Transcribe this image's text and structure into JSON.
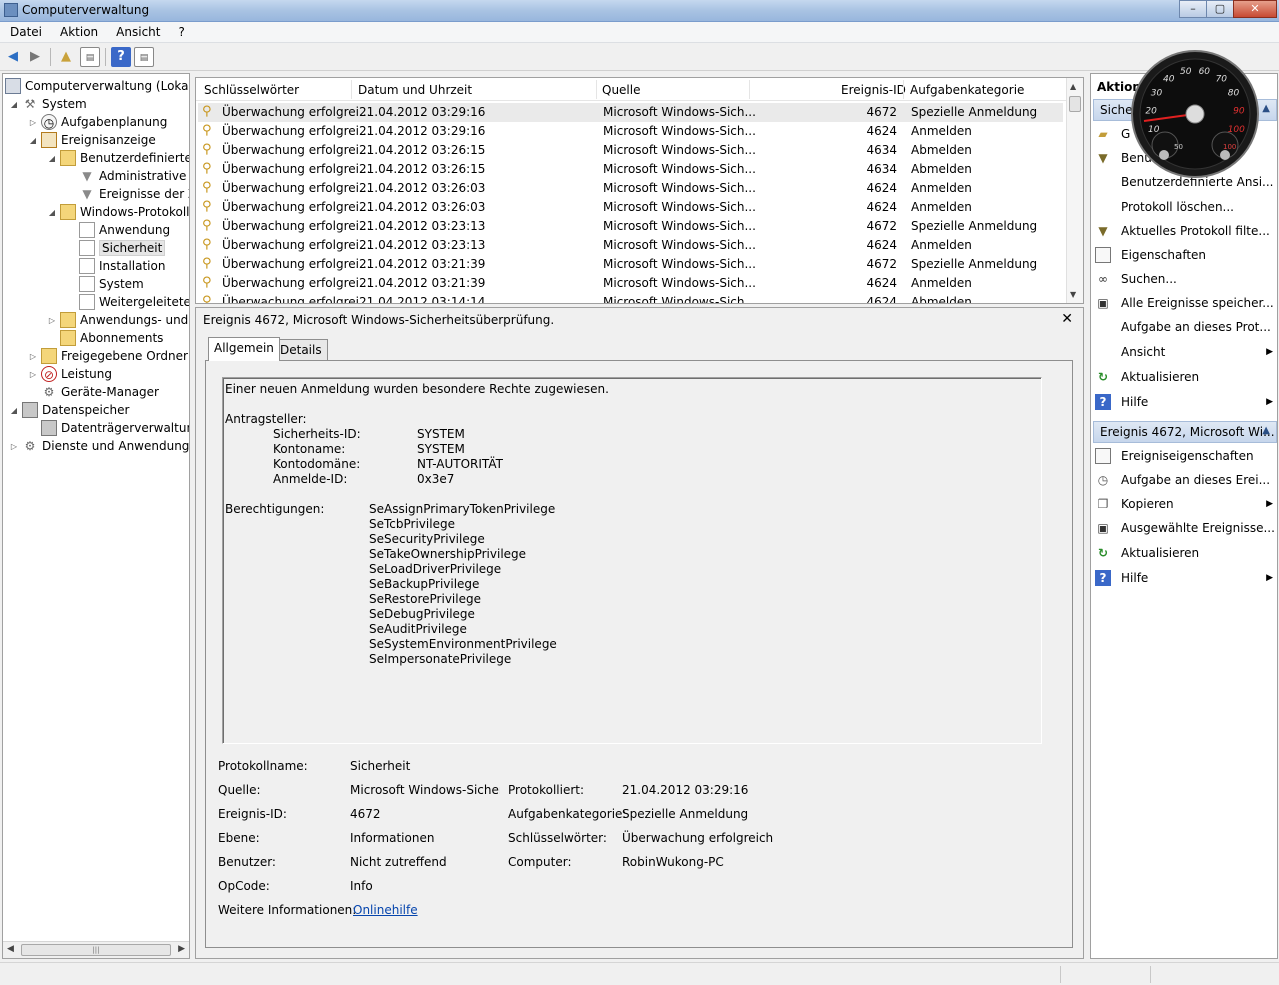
{
  "window": {
    "title": "Computerverwaltung",
    "buttons": [
      "–",
      "▢",
      "✕"
    ]
  },
  "menu": [
    "Datei",
    "Aktion",
    "Ansicht",
    "?"
  ],
  "tree": {
    "root": "Computerverwaltung (Lokal)",
    "system": "System",
    "tasks": "Aufgabenplanung",
    "eventviewer": "Ereignisanzeige",
    "custom_views": "Benutzerdefinierte A",
    "admin_events": "Administrative E",
    "events_of": "Ereignisse der Zu",
    "windows_logs": "Windows-Protokolle",
    "application": "Anwendung",
    "security": "Sicherheit",
    "setup": "Installation",
    "system_log": "System",
    "forwarded": "Weitergeleitete E",
    "app_logs": "Anwendungs- und D",
    "subscriptions": "Abonnements",
    "shared": "Freigegebene Ordner",
    "performance": "Leistung",
    "devices": "Geräte-Manager",
    "storage": "Datenspeicher",
    "disk_mgmt": "Datenträgerverwaltung",
    "services": "Dienste und Anwendungen"
  },
  "list": {
    "columns": [
      "Schlüsselwörter",
      "Datum und Uhrzeit",
      "Quelle",
      "Ereignis-ID",
      "Aufgabenkategorie"
    ],
    "rows": [
      [
        "Überwachung erfolgrei...",
        "21.04.2012 03:29:16",
        "Microsoft Windows-Sich...",
        "4672",
        "Spezielle Anmeldung"
      ],
      [
        "Überwachung erfolgrei...",
        "21.04.2012 03:29:16",
        "Microsoft Windows-Sich...",
        "4624",
        "Anmelden"
      ],
      [
        "Überwachung erfolgrei...",
        "21.04.2012 03:26:15",
        "Microsoft Windows-Sich...",
        "4634",
        "Abmelden"
      ],
      [
        "Überwachung erfolgrei...",
        "21.04.2012 03:26:15",
        "Microsoft Windows-Sich...",
        "4634",
        "Abmelden"
      ],
      [
        "Überwachung erfolgrei...",
        "21.04.2012 03:26:03",
        "Microsoft Windows-Sich...",
        "4624",
        "Anmelden"
      ],
      [
        "Überwachung erfolgrei...",
        "21.04.2012 03:26:03",
        "Microsoft Windows-Sich...",
        "4624",
        "Anmelden"
      ],
      [
        "Überwachung erfolgrei...",
        "21.04.2012 03:23:13",
        "Microsoft Windows-Sich...",
        "4672",
        "Spezielle Anmeldung"
      ],
      [
        "Überwachung erfolgrei...",
        "21.04.2012 03:23:13",
        "Microsoft Windows-Sich...",
        "4624",
        "Anmelden"
      ],
      [
        "Überwachung erfolgrei...",
        "21.04.2012 03:21:39",
        "Microsoft Windows-Sich...",
        "4672",
        "Spezielle Anmeldung"
      ],
      [
        "Überwachung erfolgrei...",
        "21.04.2012 03:21:39",
        "Microsoft Windows-Sich...",
        "4624",
        "Anmelden"
      ],
      [
        "Überwachung erfolgrei...",
        "21.04.2012 03:14:14",
        "Microsoft Windows-Sich...",
        "4624",
        "Abmelden"
      ]
    ]
  },
  "detail": {
    "title": "Ereignis 4672, Microsoft Windows-Sicherheitsüberprüfung.",
    "close": "✕",
    "tabs": [
      "Allgemein",
      "Details"
    ],
    "message": {
      "line1": "Einer neuen Anmeldung wurden besondere Rechte zugewiesen.",
      "requester": "Antragsteller:",
      "sid_label": "Sicherheits-ID:",
      "sid": "SYSTEM",
      "account_label": "Kontoname:",
      "account": "SYSTEM",
      "domain_label": "Kontodomäne:",
      "domain": "NT-AUTORITÄT",
      "logon_label": "Anmelde-ID:",
      "logon": "0x3e7",
      "privs_label": "Berechtigungen:",
      "privileges": [
        "SeAssignPrimaryTokenPrivilege",
        "SeTcbPrivilege",
        "SeSecurityPrivilege",
        "SeTakeOwnershipPrivilege",
        "SeLoadDriverPrivilege",
        "SeBackupPrivilege",
        "SeRestorePrivilege",
        "SeDebugPrivilege",
        "SeAuditPrivilege",
        "SeSystemEnvironmentPrivilege",
        "SeImpersonatePrivilege"
      ]
    },
    "fields": {
      "logname_label": "Protokollname:",
      "logname": "Sicherheit",
      "source_label": "Quelle:",
      "source": "Microsoft Windows-Sicherh",
      "logged_label": "Protokolliert:",
      "logged": "21.04.2012 03:29:16",
      "eventid_label": "Ereignis-ID:",
      "eventid": "4672",
      "taskcat_label": "Aufgabenkategorie:",
      "taskcat": "Spezielle Anmeldung",
      "level_label": "Ebene:",
      "level": "Informationen",
      "keywords_label": "Schlüsselwörter:",
      "keywords": "Überwachung erfolgreich",
      "user_label": "Benutzer:",
      "user": "Nicht zutreffend",
      "computer_label": "Computer:",
      "computer": "RobinWukong-PC",
      "opcode_label": "OpCode:",
      "opcode": "Info",
      "moreinfo_label": "Weitere Informationen:",
      "moreinfo_link": "Onlinehilfe"
    }
  },
  "actions": {
    "header": "Aktion",
    "section1": "Sicher",
    "items1": [
      "Gespeicherte Protokolldatei öffnen...",
      "Benutzerdefinierte Ansicht erstellen...",
      "Benutzerdefinierte Ansi...",
      "Protokoll löschen...",
      "Aktuelles Protokoll filte...",
      "Eigenschaften",
      "Suchen...",
      "Alle Ereignisse speicher...",
      "Aufgabe an dieses Prot...",
      "Ansicht",
      "Aktualisieren",
      "Hilfe"
    ],
    "item1_short": "G",
    "item2_short": "Benu",
    "section2": "Ereignis 4672, Microsoft Wi...",
    "items2": [
      "Ereigniseigenschaften",
      "Aufgabe an dieses Erei...",
      "Kopieren",
      "Ausgewählte Ereignisse...",
      "Aktualisieren",
      "Hilfe"
    ]
  },
  "gauge": {
    "ticks": [
      "10",
      "20",
      "30",
      "40",
      "50",
      "60",
      "70",
      "80",
      "90",
      "100"
    ],
    "sub_ticks": [
      "50",
      "100"
    ]
  }
}
